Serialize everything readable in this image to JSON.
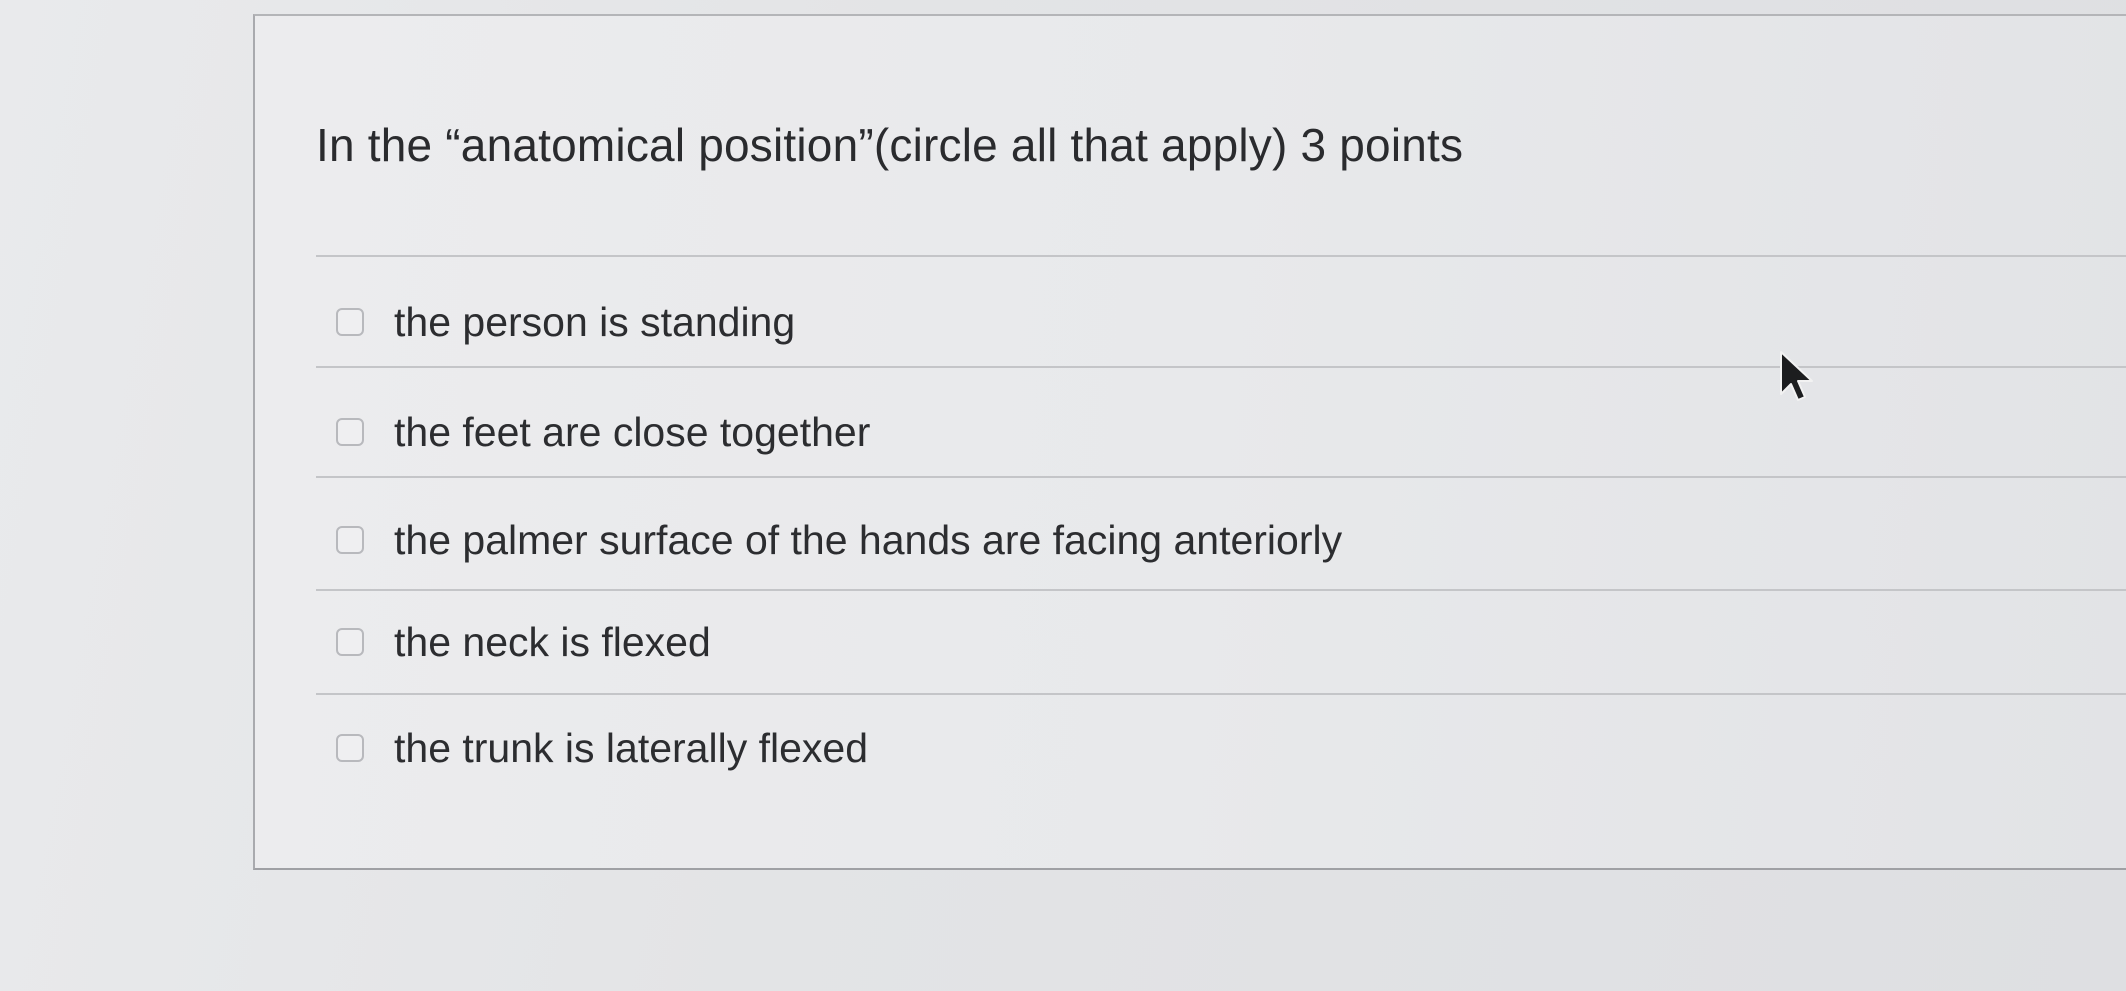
{
  "question": {
    "text": "In the “anatomical position”(circle all that apply) 3 points"
  },
  "answers": [
    {
      "label": "the person is standing",
      "checked": false
    },
    {
      "label": "the feet are close together",
      "checked": false
    },
    {
      "label": "the palmer surface of the hands are facing anteriorly",
      "checked": false
    },
    {
      "label": "the neck is flexed",
      "checked": false
    },
    {
      "label": "the trunk is laterally flexed",
      "checked": false
    }
  ],
  "icons": {
    "checkbox": "checkbox-icon",
    "cursor": "mouse-pointer-icon"
  }
}
